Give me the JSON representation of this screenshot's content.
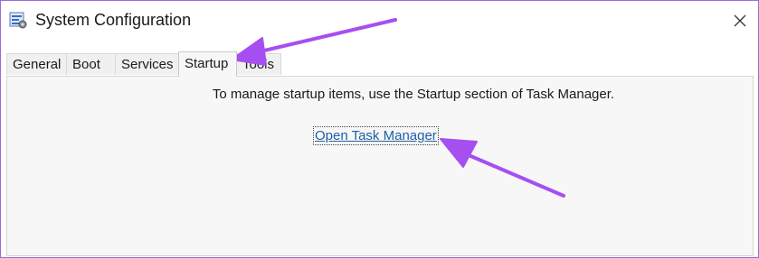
{
  "window": {
    "title": "System Configuration",
    "icons": {
      "app": "system-configuration-icon",
      "close": "close-icon"
    }
  },
  "tabs": [
    {
      "label": "General"
    },
    {
      "label": "Boot"
    },
    {
      "label": "Services"
    },
    {
      "label": "Startup",
      "active": true
    },
    {
      "label": "Tools"
    }
  ],
  "panel": {
    "message": "To manage startup items, use the Startup section of Task Manager.",
    "link_label": "Open Task Manager"
  },
  "annotation": {
    "arrow_color": "#a64ff0"
  }
}
